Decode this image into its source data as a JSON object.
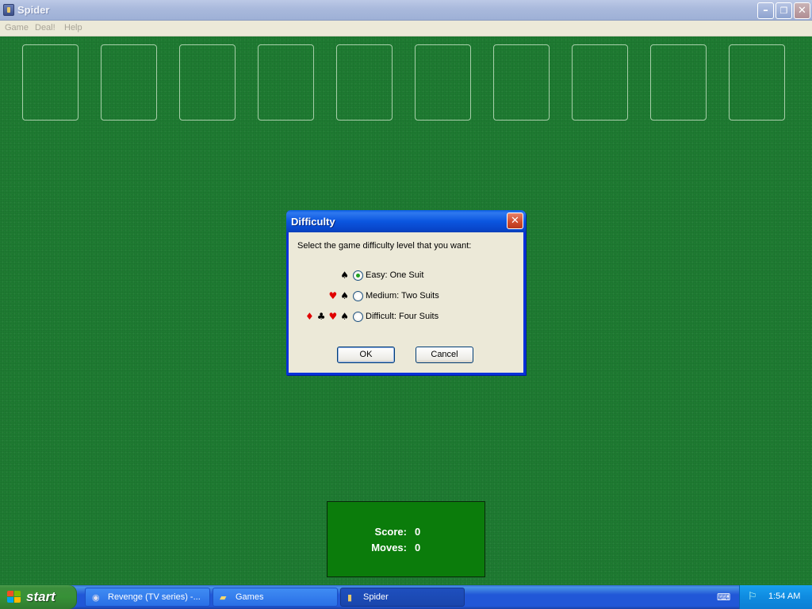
{
  "window": {
    "title": "Spider",
    "buttons": {
      "minimize": "–",
      "restore": "❐",
      "close": "✕"
    }
  },
  "menu": {
    "items": [
      "Game",
      "Deal!",
      "Help"
    ]
  },
  "game": {
    "foundation_slots": 10,
    "score_label": "Score:",
    "score_value": "0",
    "moves_label": "Moves:",
    "moves_value": "0"
  },
  "dialog": {
    "title": "Difficulty",
    "prompt": "Select the game difficulty level that you want:",
    "options": [
      {
        "label": "Easy: One Suit",
        "suits": [
          "spade"
        ],
        "checked": true
      },
      {
        "label": "Medium: Two Suits",
        "suits": [
          "heart",
          "spade"
        ],
        "checked": false
      },
      {
        "label": "Difficult: Four Suits",
        "suits": [
          "diamond",
          "club",
          "heart",
          "spade"
        ],
        "checked": false
      }
    ],
    "ok_label": "OK",
    "cancel_label": "Cancel"
  },
  "taskbar": {
    "start_label": "start",
    "tasks": [
      {
        "label": "Revenge (TV series) -...",
        "icon": "browser-icon",
        "active": false
      },
      {
        "label": "Games",
        "icon": "folder-icon",
        "active": false
      },
      {
        "label": "Spider",
        "icon": "spider-app-icon",
        "active": true
      }
    ],
    "clock": "1:54 AM"
  },
  "colors": {
    "felt": "#1e7b31",
    "dialog_title": "#0b56e0",
    "taskbar": "#2157d7",
    "start": "#379137"
  }
}
